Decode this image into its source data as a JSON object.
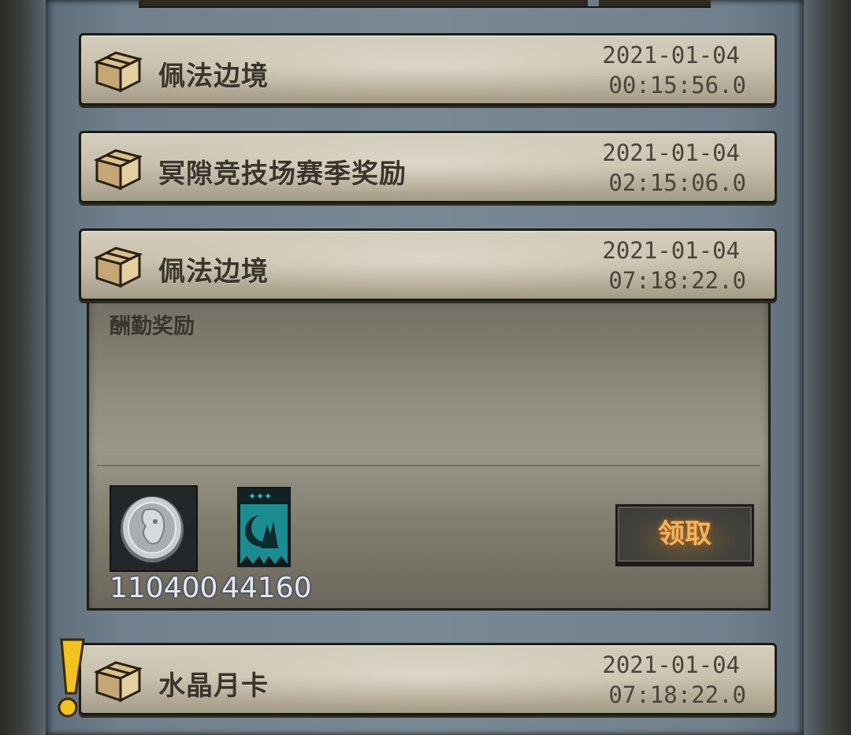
{
  "mails": [
    {
      "title": "佩法边境",
      "date": "2021-01-04",
      "time": "00:15:56.0"
    },
    {
      "title": "冥隙竞技场赛季奖励",
      "date": "2021-01-04",
      "time": "02:15:06.0"
    },
    {
      "title": "佩法边境",
      "date": "2021-01-04",
      "time": "07:18:22.0"
    },
    {
      "title": "水晶月卡",
      "date": "2021-01-04",
      "time": "07:18:22.0"
    }
  ],
  "detail": {
    "description": "酬勤奖励",
    "rewards": [
      {
        "icon": "silver-coin-icon",
        "count": "110400"
      },
      {
        "icon": "moon-banner-icon",
        "count": "44160"
      }
    ],
    "claim_label": "领取"
  },
  "colors": {
    "panel": "#798994",
    "parchment": "#c8c1ad",
    "claim_text": "#f2b464",
    "alert": "#f3c21e"
  }
}
